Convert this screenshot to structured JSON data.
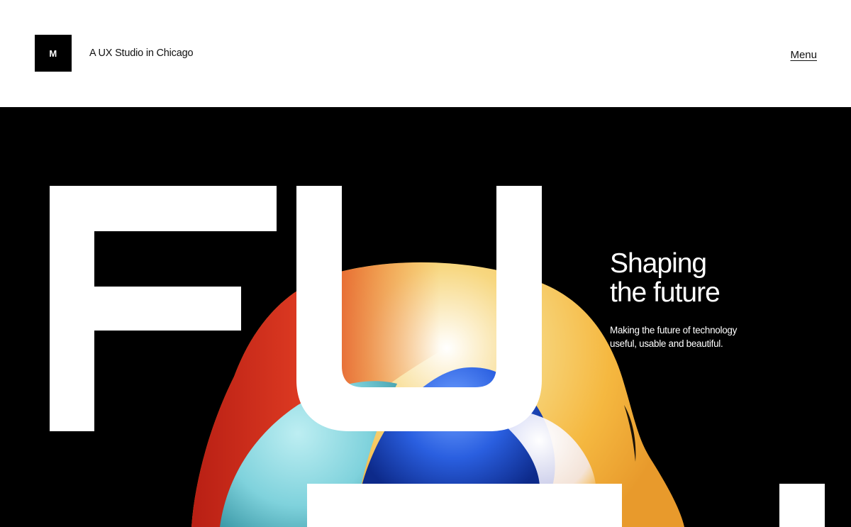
{
  "header": {
    "logo_letter": "M",
    "tagline": "A UX Studio in Chicago",
    "menu_label": "Menu"
  },
  "hero": {
    "big_word": "FU",
    "title_line1": "Shaping",
    "title_line2": "the future",
    "subtitle_line1": "Making the future of technology",
    "subtitle_line2": "useful, usable and beautiful."
  },
  "colors": {
    "background": "#000000",
    "header_bg": "#ffffff",
    "text_light": "#ffffff",
    "text_dark": "#111111",
    "blob_red": "#d8321f",
    "blob_orange": "#e8872a",
    "blob_yellow": "#f5c23a",
    "blob_blue": "#2a5fe0",
    "blob_cyan": "#7fd2dc"
  }
}
